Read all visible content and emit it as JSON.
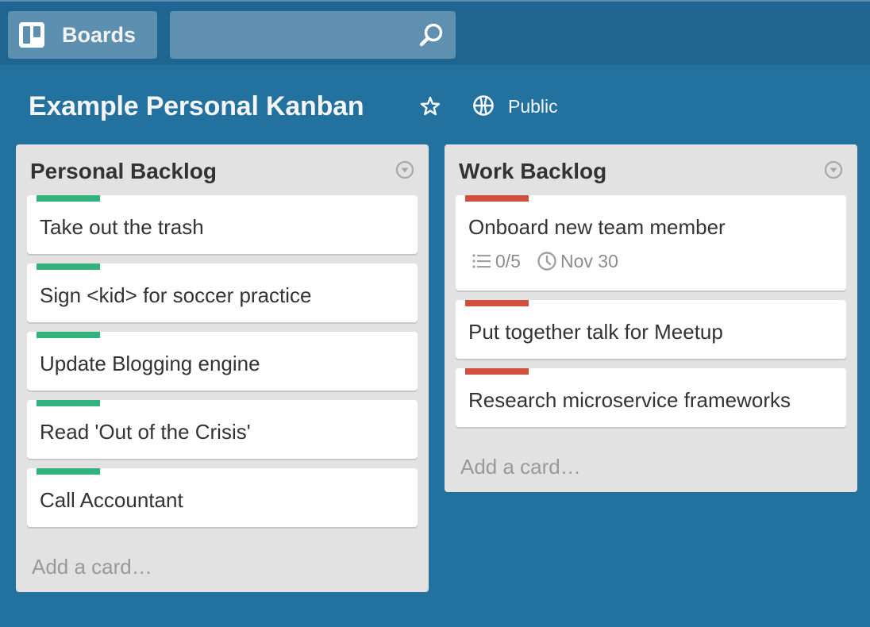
{
  "header": {
    "boards_label": "Boards",
    "search": {
      "value": "",
      "placeholder": ""
    }
  },
  "board": {
    "title": "Example Personal Kanban",
    "visibility": "Public",
    "starred": false
  },
  "colors": {
    "background": "#23719f",
    "header": "#1f6591",
    "list_bg": "#e2e2e2",
    "label_green": "#34b27d",
    "label_red": "#cf513d"
  },
  "lists": [
    {
      "title": "Personal Backlog",
      "add_card_label": "Add a card…",
      "cards": [
        {
          "title": "Take out the trash",
          "label_color": "green"
        },
        {
          "title": "Sign <kid> for soccer practice",
          "label_color": "green"
        },
        {
          "title": "Update Blogging engine",
          "label_color": "green"
        },
        {
          "title": "Read 'Out of the Crisis'",
          "label_color": "green"
        },
        {
          "title": "Call Accountant",
          "label_color": "green"
        }
      ]
    },
    {
      "title": "Work Backlog",
      "add_card_label": "Add a card…",
      "cards": [
        {
          "title": "Onboard new team member",
          "label_color": "red",
          "checklist": "0/5",
          "due": "Nov 30"
        },
        {
          "title": "Put together talk for Meetup",
          "label_color": "red"
        },
        {
          "title": "Research microservice frameworks",
          "label_color": "red"
        }
      ]
    }
  ]
}
